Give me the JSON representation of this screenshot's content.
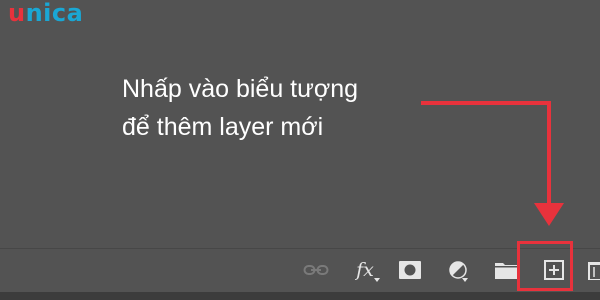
{
  "brand": {
    "logo_first": "u",
    "logo_rest": "nica"
  },
  "annotation": {
    "line1": "Nhấp vào biểu tượng",
    "line2": "để thêm layer mới"
  },
  "toolbar": {
    "fx_label": "fx",
    "icons": [
      "link-icon",
      "fx-icon",
      "mask-icon",
      "adjustment-icon",
      "folder-icon",
      "new-layer-icon",
      "trash-icon"
    ]
  },
  "colors": {
    "panel_bg": "#535353",
    "highlight": "#e8323c",
    "logo_red": "#e8323c",
    "logo_blue": "#1aa7d4"
  }
}
